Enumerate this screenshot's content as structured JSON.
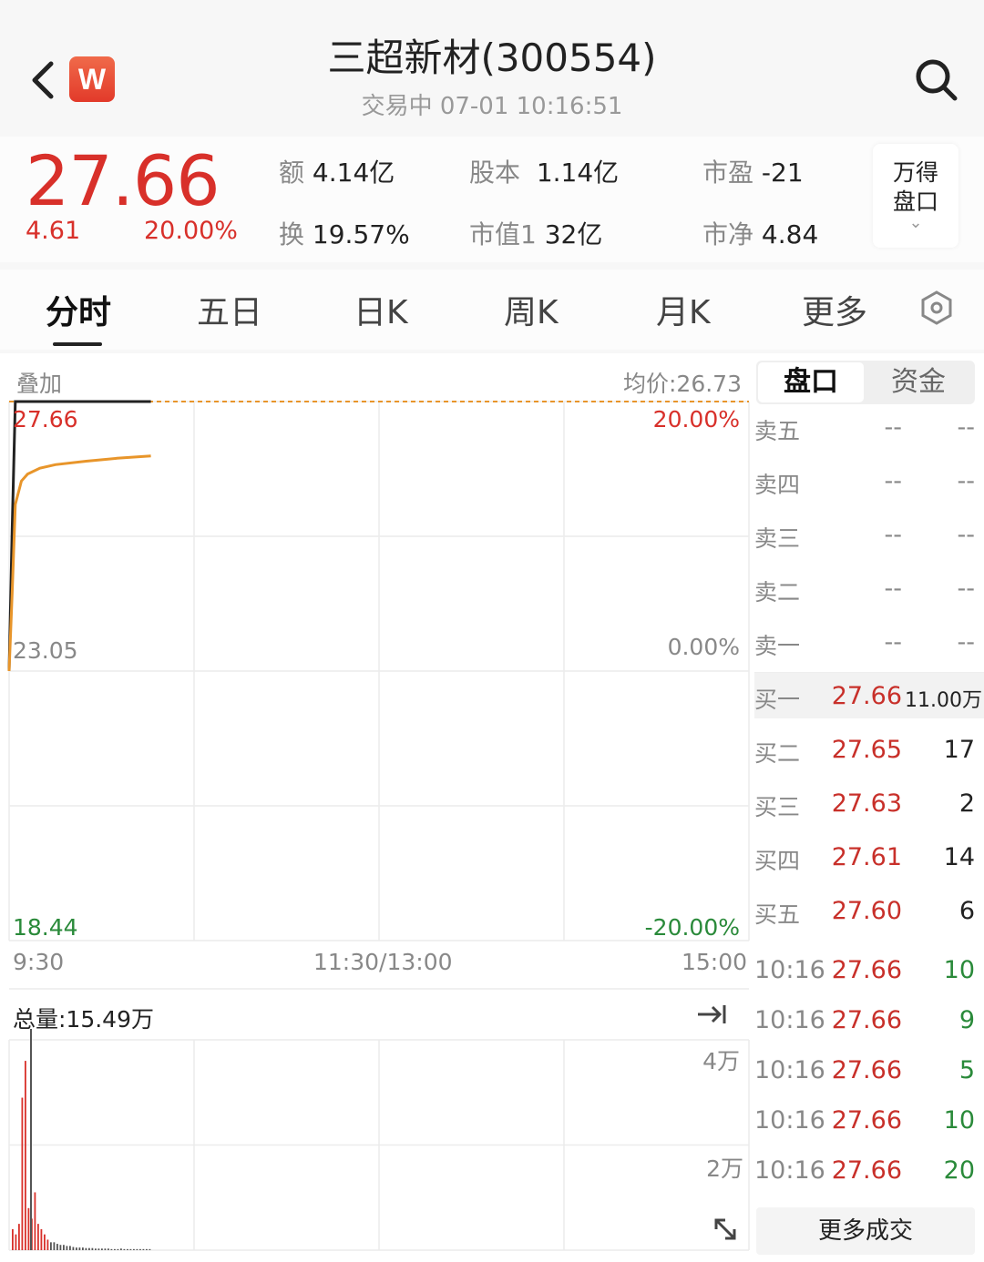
{
  "header": {
    "badge": "W",
    "title": "三超新材(300554)",
    "subtitle": "交易中  07-01  10:16:51"
  },
  "quote": {
    "last_price": "27.66",
    "change_amount": "4.61",
    "change_percent": "20.00%",
    "stats": [
      {
        "key": "额",
        "value": "4.14亿"
      },
      {
        "key": "股本",
        "value": "1.14亿"
      },
      {
        "key": "市盈",
        "value": "-21"
      },
      {
        "key": "换",
        "value": "19.57%"
      },
      {
        "key": "市值1",
        "value": "32亿"
      },
      {
        "key": "市净",
        "value": "4.84"
      }
    ],
    "panel_button": {
      "line1": "万得",
      "line2": "盘口"
    }
  },
  "tabs": [
    "分时",
    "五日",
    "日K",
    "周K",
    "月K",
    "更多"
  ],
  "chart": {
    "overlay_label": "叠加",
    "avg_label": "均价:26.73",
    "price_high": "27.66",
    "price_mid": "23.05",
    "price_low": "18.44",
    "pct_high": "20.00%",
    "pct_mid": "0.00%",
    "pct_low": "-20.00%",
    "time_start": "9:30",
    "time_mid": "11:30/13:00",
    "time_end": "15:00",
    "volume_total": "总量:15.49万",
    "vol_tick_high": "4万",
    "vol_tick_mid": "2万",
    "colors": {
      "price_line": "#222222",
      "avg_line": "#e8952a",
      "limit_line": "#e8952a",
      "up": "#d8302a"
    }
  },
  "chart_data": {
    "type": "line",
    "x": [
      "9:30",
      "9:31",
      "9:32",
      "9:34",
      "9:36",
      "9:40",
      "9:45",
      "9:55",
      "10:05",
      "10:16"
    ],
    "series": [
      {
        "values": [
          23.05,
          25.5,
          27.66,
          27.66,
          27.66,
          27.66,
          27.66,
          27.66,
          27.66,
          27.66
        ]
      },
      {
        "values": [
          23.05,
          24.4,
          25.9,
          26.3,
          26.42,
          26.52,
          26.58,
          26.64,
          26.69,
          26.73
        ]
      }
    ],
    "ylim": [
      18.44,
      27.66
    ],
    "volume": [
      0.4,
      0.3,
      0.5,
      2.9,
      3.6,
      0.8,
      0.6,
      1.1,
      0.5,
      0.4,
      0.3,
      0.2,
      0.15,
      0.15,
      0.12,
      0.1,
      0.1,
      0.08,
      0.08,
      0.06,
      0.05,
      0.05,
      0.05,
      0.04,
      0.04,
      0.04,
      0.03,
      0.03,
      0.03,
      0.03,
      0.03,
      0.02,
      0.02,
      0.02,
      0.03,
      0.02,
      0.02,
      0.02,
      0.02,
      0.02,
      0.02,
      0.02,
      0.02,
      0.02
    ],
    "volume_ylim": [
      0,
      4
    ]
  },
  "order_book": {
    "tabs": [
      "盘口",
      "资金"
    ],
    "asks": [
      {
        "label": "卖五",
        "price": "--",
        "volume": "--"
      },
      {
        "label": "卖四",
        "price": "--",
        "volume": "--"
      },
      {
        "label": "卖三",
        "price": "--",
        "volume": "--"
      },
      {
        "label": "卖二",
        "price": "--",
        "volume": "--"
      },
      {
        "label": "卖一",
        "price": "--",
        "volume": "--"
      }
    ],
    "bids": [
      {
        "label": "买一",
        "price": "27.66",
        "volume": "11.00万"
      },
      {
        "label": "买二",
        "price": "27.65",
        "volume": "17"
      },
      {
        "label": "买三",
        "price": "27.63",
        "volume": "2"
      },
      {
        "label": "买四",
        "price": "27.61",
        "volume": "14"
      },
      {
        "label": "买五",
        "price": "27.60",
        "volume": "6"
      }
    ],
    "ticks": [
      {
        "time": "10:16",
        "price": "27.66",
        "volume": "10"
      },
      {
        "time": "10:16",
        "price": "27.66",
        "volume": "9"
      },
      {
        "time": "10:16",
        "price": "27.66",
        "volume": "5"
      },
      {
        "time": "10:16",
        "price": "27.66",
        "volume": "10"
      },
      {
        "time": "10:16",
        "price": "27.66",
        "volume": "20"
      }
    ],
    "more_trades": "更多成交"
  }
}
